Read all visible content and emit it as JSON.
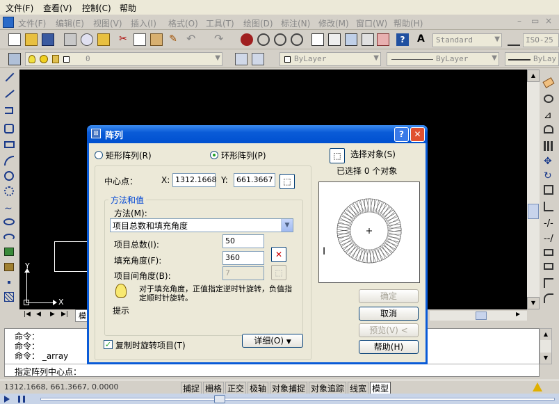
{
  "menubar": {
    "items": [
      "文件(F)",
      "查看(V)",
      "控制(C)",
      "帮助"
    ]
  },
  "app_menubar": {
    "items": [
      "文件(F)",
      "编辑(E)",
      "视图(V)",
      "插入(I)",
      "格式(O)",
      "工具(T)",
      "绘图(D)",
      "标注(N)",
      "修改(M)",
      "窗口(W)",
      "帮助(H)"
    ]
  },
  "toolbar": {
    "text_style": "Standard",
    "dim_style": "ISO-25"
  },
  "layers": {
    "current_layer": "0",
    "color": "ByLayer",
    "linetype": "ByLayer",
    "lineweight": "ByLay"
  },
  "drawing": {
    "ucs_y": "Y",
    "ucs_x": "X",
    "tab_model": "模"
  },
  "command": {
    "lines": [
      "命令：",
      "命令：",
      "命令：  _array"
    ],
    "prompt": "指定阵列中心点："
  },
  "status": {
    "coords": "1312.1668, 661.3667, 0.0000",
    "buttons": [
      "捕捉",
      "栅格",
      "正交",
      "极轴",
      "对象捕捉",
      "对象追踪",
      "线宽",
      "模型"
    ]
  },
  "dialog": {
    "title": "阵列",
    "rect_option": "矩形阵列(R)",
    "polar_option": "环形阵列(P)",
    "select_objects": "选择对象(S)",
    "selected_count": "已选择 0 个对象",
    "center_label": "中心点：",
    "x_label": "X:",
    "x_value": "1312.1668",
    "y_label": "Y:",
    "y_value": "661.3667",
    "method_group": "方法和值",
    "method_label": "方法(M):",
    "method_value": "项目总数和填充角度",
    "total_label": "项目总数(I):",
    "total_value": "50",
    "fill_label": "填充角度(F):",
    "fill_value": "360",
    "between_label": "项目间角度(B):",
    "between_value": "7",
    "tip_text": "对于填充角度，正值指定逆时针旋转，负值指定顺时针旋转。",
    "tip_label": "提示",
    "rotate_items": "复制时旋转项目(T)",
    "details": "详细(O)",
    "ok": "确定",
    "cancel": "取消",
    "preview": "预览(V)",
    "help": "帮助(H)"
  },
  "colors": {
    "title_bar": "#0a5bd7",
    "canvas": "#000000",
    "dialog_bg": "#ece9d8"
  }
}
